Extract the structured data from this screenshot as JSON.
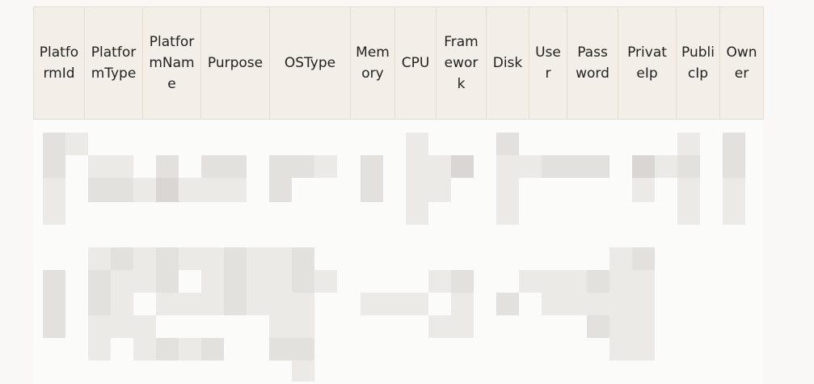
{
  "table": {
    "columns": [
      "PlatformId",
      "PlatformType",
      "PlatformName",
      "Purpose",
      "OSType",
      "Memory",
      "CPU",
      "Framework",
      "Disk",
      "User",
      "Password",
      "PrivateIp",
      "PublicIp",
      "Owner"
    ]
  },
  "colors": {
    "header_bg": "#f3eee7",
    "header_border": "#e4dcd1",
    "page_bg": "#f9f8f6",
    "blur_light": "#eceae7",
    "blur_mid": "#e3e1de",
    "blur_dark": "#d9d6d3"
  }
}
